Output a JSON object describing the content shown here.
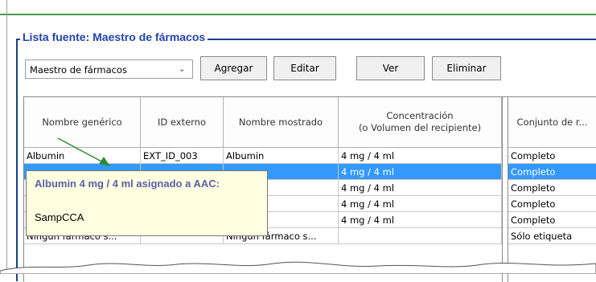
{
  "group": {
    "title": "Lista fuente: Maestro de fármacos"
  },
  "source_select": {
    "value": "Maestro de fármacos"
  },
  "toolbar": {
    "add": "Agregar",
    "edit": "Editar",
    "view": "Ver",
    "delete": "Eliminar"
  },
  "table": {
    "headers": [
      "Nombre genérico",
      "ID externo",
      "Nombre mostrado",
      "Concentración\n(o Volumen del recipiente)",
      "Conjunto de r..."
    ],
    "rows": [
      {
        "generic": "Albumin",
        "ext_id": "EXT_ID_003",
        "display": "Albumin",
        "conc": "4 mg / 4 ml",
        "set": "Completo"
      },
      {
        "generic": "",
        "ext_id": "",
        "display": "",
        "conc": "4 mg / 4 ml",
        "set": "Completo"
      },
      {
        "generic": "",
        "ext_id": "",
        "display": "",
        "conc": "4 mg / 4 ml",
        "set": "Completo"
      },
      {
        "generic": "",
        "ext_id": "",
        "display": "",
        "conc": "4 mg / 4 ml",
        "set": "Completo"
      },
      {
        "generic": "",
        "ext_id": "",
        "display": "",
        "conc": "4 mg / 4 ml",
        "set": "Completo"
      },
      {
        "generic": "Ningún fármaco s...",
        "ext_id": "",
        "display": "Ningún fármaco s...",
        "conc": "",
        "set": "Sólo etiqueta"
      }
    ]
  },
  "tooltip": {
    "title": "Albumin 4 mg / 4 ml asignado a AAC:",
    "value": "SampCCA"
  },
  "colors": {
    "accent": "#2244a8",
    "selection": "#3399ff",
    "tooltip_bg": "#ffffe1",
    "top_line": "#4a9a4a"
  }
}
